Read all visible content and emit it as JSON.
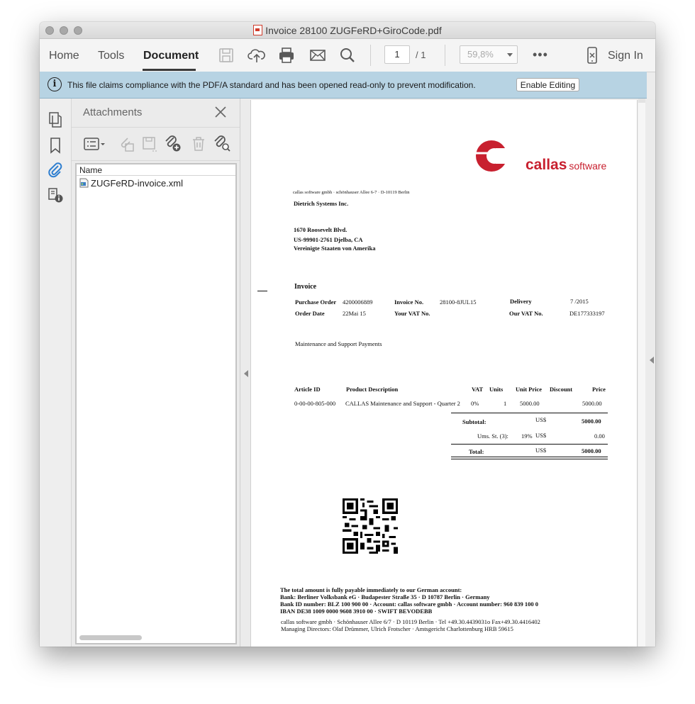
{
  "window": {
    "title": "Invoice 28100 ZUGFeRD+GiroCode.pdf"
  },
  "toolbar": {
    "nav": [
      "Home",
      "Tools",
      "Document"
    ],
    "page_current": "1",
    "page_total": "/  1",
    "zoom": "59,8%",
    "more": "•••",
    "sign_in": "Sign In",
    "icons": [
      "save-icon",
      "upload-icon",
      "print-icon",
      "email-icon",
      "search-icon",
      "mobile-icon"
    ]
  },
  "infobar": {
    "message": "This file claims compliance with the PDF/A standard and has been opened read-only to prevent modification.",
    "button": "Enable Editing"
  },
  "attachments": {
    "title": "Attachments",
    "column_name": "Name",
    "files": [
      "ZUGFeRD-invoice.xml"
    ]
  },
  "document": {
    "logo": {
      "name": "callas",
      "suffix": "software"
    },
    "sender_line": "callas software gmbh · schönhauser Allee 6-7 · D-10119 Berlin",
    "recipient": {
      "name": "Dietrich Systems Inc.",
      "street": "1670 Roosevelt Blvd.",
      "city": "US-99901-2761 Djelba, CA",
      "country": "Vereinigte Staaten von Amerika"
    },
    "invoice_title": "Invoice",
    "meta": {
      "po_label": "Purchase Order",
      "po_value": "4200006889",
      "invoice_no_label": "Invoice No.",
      "invoice_no_value": "28100-8JUL15",
      "delivery_label": "Delivery",
      "delivery_value": "7 /2015",
      "order_date_label": "Order Date",
      "order_date_value": "22Mai 15",
      "your_vat_label": "Your VAT No.",
      "our_vat_label": "Our VAT No.",
      "our_vat_value": "DE177333197"
    },
    "subject": "Maintenance and Support Payments",
    "table": {
      "headers": [
        "Article ID",
        "Product Description",
        "VAT",
        "Units",
        "Unit Price",
        "Discount",
        "Price"
      ],
      "row": {
        "article_id": "0-00-00-805-000",
        "description": "CALLAS Maintenance and Support - Quarter 2",
        "vat": "0%",
        "units": "1",
        "unit_price": "5000.00",
        "price": "5000.00"
      }
    },
    "totals": {
      "subtotal_label": "Subtotal:",
      "subtotal_currency": "US$",
      "subtotal_value": "5000.00",
      "tax_label": "Ums. St. (3):",
      "tax_rate": "19%",
      "tax_currency": "US$",
      "tax_value": "0.00",
      "total_label": "Total:",
      "total_currency": "US$",
      "total_value": "5000.00"
    },
    "payment": {
      "line1": "The total amount is fully payable immediately to our German account:",
      "line2": "Bank: Berliner Volksbank eG  ·  Budapester Straße 35  ·  D 10787 Berlin  ·  Germany",
      "line3": "Bank ID number: BLZ 100 900 00  ·  Account: callas software gmbh  ·  Account number: 960 839 100 0",
      "line4": "IBAN DE38 1009 0000 9608 3910 00  ·  SWIFT BEVODEBB"
    },
    "footer": {
      "line1": "callas software gmbh · Schönhauser Allee 6/7 · D 10119 Berlin · Tel +49.30.4439031o Fax+49.30.4416402",
      "line2": "Managing Directors: Olaf Drümmer, Ulrich Frotscher · Amtsgericht Charlottenburg HRB 59615"
    }
  },
  "colors": {
    "infobar": "#b7d3e3",
    "brand_red": "#c8202f",
    "attachment_icon_blue": "#2f7fd0"
  }
}
